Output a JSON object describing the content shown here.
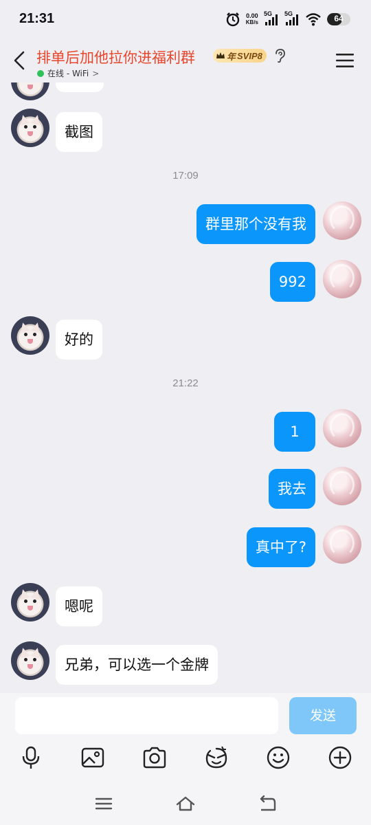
{
  "status_bar": {
    "time": "21:31",
    "net_speed_value": "0.00",
    "net_speed_unit": "KB/s",
    "signal1_label": "5G",
    "signal2_label": "5G",
    "battery_level": "64",
    "battery_fraction": 0.64
  },
  "header": {
    "title": "排单后加他拉你进福利群",
    "badge_prefix": "年",
    "badge_label": "SVIP8",
    "online_status": "在线 - WiFi",
    "online_chevron": ">"
  },
  "messages": [
    {
      "type": "in",
      "text": "截图"
    },
    {
      "type": "time",
      "text": "17:09"
    },
    {
      "type": "out",
      "text": "群里那个没有我"
    },
    {
      "type": "out",
      "text": "992"
    },
    {
      "type": "in",
      "text": "好的"
    },
    {
      "type": "time",
      "text": "21:22"
    },
    {
      "type": "out",
      "text": "1"
    },
    {
      "type": "out",
      "text": "我去"
    },
    {
      "type": "out",
      "text": "真中了?"
    },
    {
      "type": "in",
      "text": "嗯呢"
    },
    {
      "type": "in",
      "text": "兄弟，可以选一个金牌"
    }
  ],
  "input": {
    "placeholder": "",
    "send_label": "发送"
  },
  "toolbar": {
    "icons": [
      "microphone-icon",
      "image-icon",
      "camera-icon",
      "sticker-icon",
      "emoji-icon",
      "plus-icon"
    ]
  },
  "nav": {
    "icons": [
      "menu-icon",
      "home-icon",
      "back-icon"
    ]
  },
  "colors": {
    "accent_blue": "#0a96fb",
    "title_red": "#e8462c",
    "online_green": "#2fc25b",
    "send_disabled": "#7ec7f8"
  }
}
